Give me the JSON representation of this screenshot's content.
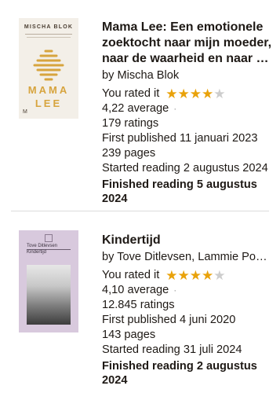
{
  "books": [
    {
      "title_line1": "Mama Lee: Een emotionele",
      "title_line2": "zoektocht naar mijn moeder,",
      "title_line3": "naar de waarheid en naar o...",
      "author": "by Mischa Blok",
      "rated_label": "You rated it",
      "user_stars": 4,
      "average": "4,22 average",
      "ratings": "179 ratings",
      "published": "First published 11 januari 2023",
      "pages": "239 pages",
      "started": "Started reading 2 augustus 2024",
      "finished_line1": "Finished reading 5 augustus",
      "finished_line2": "2024",
      "cover": {
        "author_text": "MISCHA BLOK",
        "title_top": "MAMA",
        "title_bottom": "LEE",
        "publisher_mark": "M",
        "colors": {
          "bg": "#f3efe8",
          "accent": "#d7a43e"
        }
      }
    },
    {
      "title_line1": "Kindertijd",
      "author": "by Tove Ditlevsen, Lammie Post-...",
      "rated_label": "You rated it",
      "user_stars": 4,
      "average": "4,10 average",
      "ratings": "12.845 ratings",
      "published": "First published 4 juni 2020",
      "pages": "143 pages",
      "started": "Started reading 31 juli 2024",
      "finished_line1": "Finished reading 2 augustus",
      "finished_line2": "2024",
      "cover": {
        "author_text": "Tove Ditlevsen",
        "title_text": "Kindertijd",
        "colors": {
          "bg": "#d8c9dd"
        }
      }
    }
  ],
  "theme": {
    "star_on": "#e9a20a",
    "star_off": "#cdcdcd",
    "divider": "#dcdcdc"
  }
}
